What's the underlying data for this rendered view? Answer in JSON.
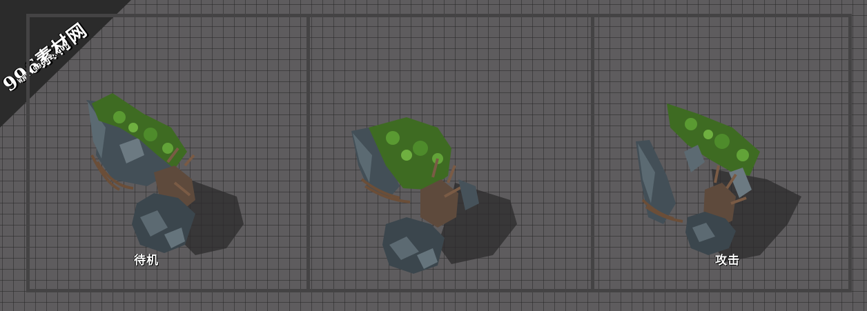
{
  "watermark": {
    "title": "996素材网",
    "url": "WWW.996n2.COM"
  },
  "panels": [
    {
      "label": "待机"
    },
    {
      "label": ""
    },
    {
      "label": "攻击"
    }
  ],
  "colors": {
    "background": "#5e5c5e",
    "grid_line": "#3a393a",
    "frame": "#444344",
    "rock": "#3f4a52",
    "moss": "#4f8a2a",
    "root": "#6b4e38"
  }
}
